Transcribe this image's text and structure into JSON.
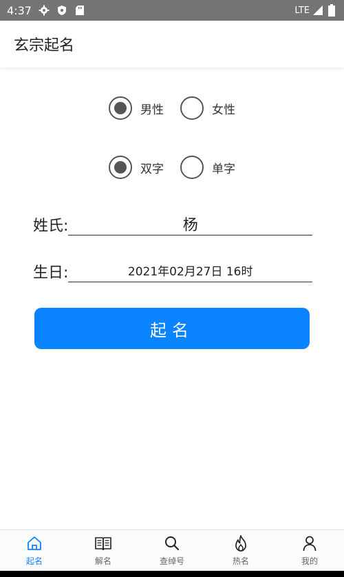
{
  "status_bar": {
    "time": "4:37",
    "network": "LTE"
  },
  "app_bar": {
    "title": "玄宗起名"
  },
  "gender": {
    "options": [
      {
        "label": "男性",
        "selected": true
      },
      {
        "label": "女性",
        "selected": false
      }
    ]
  },
  "name_length": {
    "options": [
      {
        "label": "双字",
        "selected": true
      },
      {
        "label": "单字",
        "selected": false
      }
    ]
  },
  "surname": {
    "label": "姓氏:",
    "value": "杨"
  },
  "birthday": {
    "label": "生日:",
    "value": "2021年02月27日 16时"
  },
  "submit": {
    "label": "起名"
  },
  "bottom_nav": {
    "accent": "#0a84ff",
    "items": [
      {
        "label": "起名",
        "icon": "home-icon",
        "active": true
      },
      {
        "label": "解名",
        "icon": "book-icon",
        "active": false
      },
      {
        "label": "查绰号",
        "icon": "search-icon",
        "active": false
      },
      {
        "label": "热名",
        "icon": "flame-icon",
        "active": false
      },
      {
        "label": "我的",
        "icon": "person-icon",
        "active": false
      }
    ]
  }
}
